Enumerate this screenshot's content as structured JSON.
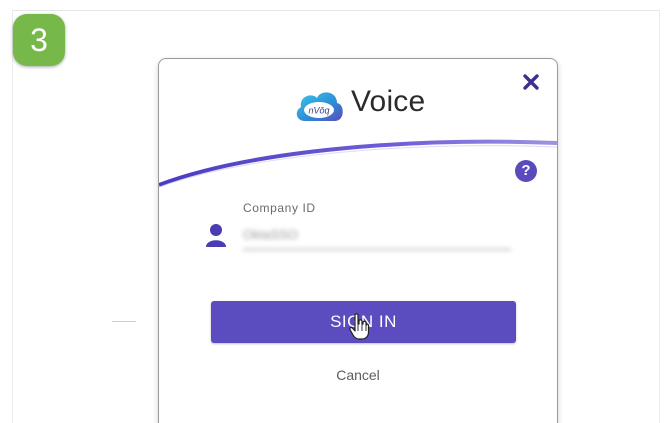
{
  "step": {
    "number": "3",
    "color": "#76b84a"
  },
  "dialog": {
    "logo_text": "nVōq",
    "title": "Voice",
    "close_icon": "close-icon",
    "help_icon": "help-icon",
    "help_glyph": "?",
    "accent_color": "#5b4cbf"
  },
  "form": {
    "company_label": "Company ID",
    "company_value": "OktaSSO",
    "user_icon": "user-icon"
  },
  "actions": {
    "signin_label": "SIGN IN",
    "cancel_label": "Cancel"
  }
}
